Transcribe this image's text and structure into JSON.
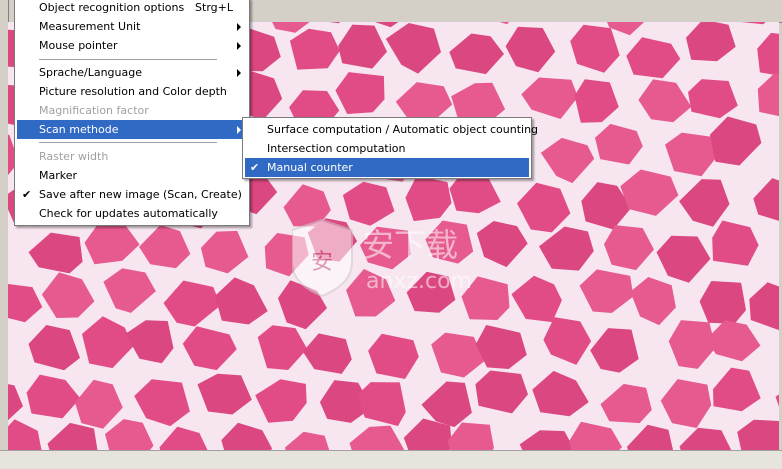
{
  "main_menu": {
    "items": [
      {
        "label": "Object recognition options",
        "shortcut": "Strg+L"
      },
      {
        "label": "Measurement Unit",
        "submenu": true
      },
      {
        "label": "Mouse pointer",
        "submenu": true
      },
      {
        "label": "Sprache/Language",
        "submenu": true
      },
      {
        "label": "Picture resolution and Color depth"
      },
      {
        "label": "Magnification factor",
        "disabled": true
      },
      {
        "label": "Scan methode",
        "submenu": true,
        "highlighted": true
      },
      {
        "label": "Raster width",
        "disabled": true
      },
      {
        "label": "Marker"
      },
      {
        "label": "Save after new image (Scan, Create)",
        "checked": true
      },
      {
        "label": "Check for updates automatically"
      }
    ]
  },
  "scan_submenu": {
    "items": [
      {
        "label": "Surface computation / Automatic object counting"
      },
      {
        "label": "Intersection computation"
      },
      {
        "label": "Manual counter",
        "checked": true,
        "highlighted": true
      }
    ]
  },
  "checkmark": "✔",
  "image": {
    "background_color": "#f4d7e6",
    "cell_color": "#e24c86",
    "membrane_color": "#f7e6f0"
  },
  "watermark": {
    "text": "安下载",
    "domain": "anxz.com"
  },
  "colors": {
    "highlight": "#316ac5",
    "disabled_text": "#a0a0a0",
    "menu_bg": "#ffffff"
  }
}
